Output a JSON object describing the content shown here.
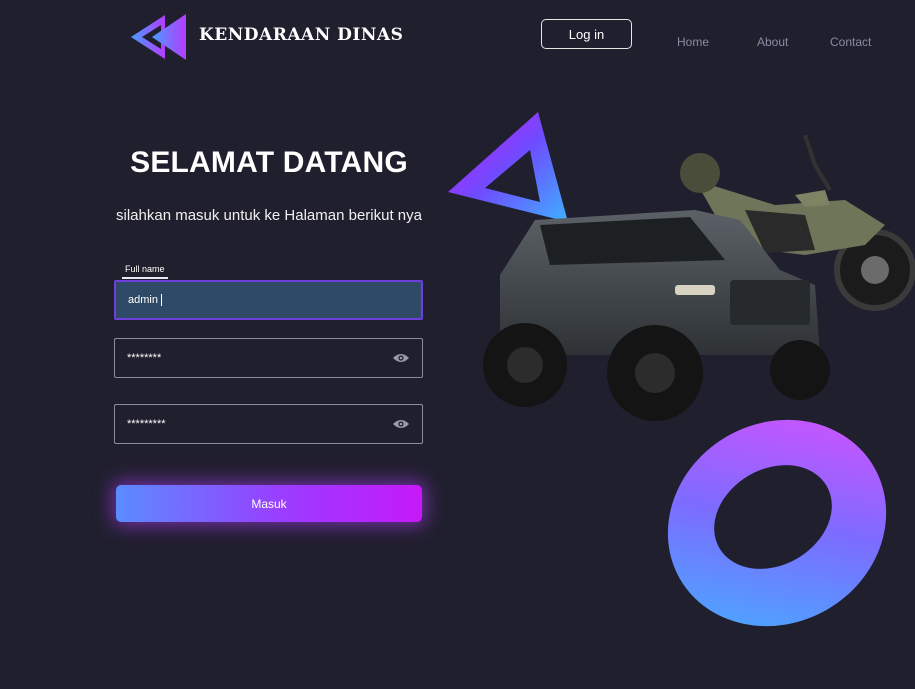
{
  "header": {
    "brand": "KENDARAAN DINAS",
    "login_label": "Log in",
    "nav": [
      "Home",
      "About",
      "Contact"
    ]
  },
  "main": {
    "title": "SELAMAT DATANG",
    "subtitle": "silahkan masuk untuk ke Halaman berikut nya",
    "fullname_label": "Full name",
    "fullname_value": "admin",
    "password_mask": "********",
    "confirm_mask": "*********",
    "submit_label": "Masuk"
  },
  "icons": {
    "logo": "double-triangle-logo-icon",
    "eye": "eye-icon"
  },
  "colors": {
    "background": "#201f2e",
    "accent_start": "#5a8cff",
    "accent_end": "#c619f8",
    "input_active_bg": "#2e4a66"
  }
}
